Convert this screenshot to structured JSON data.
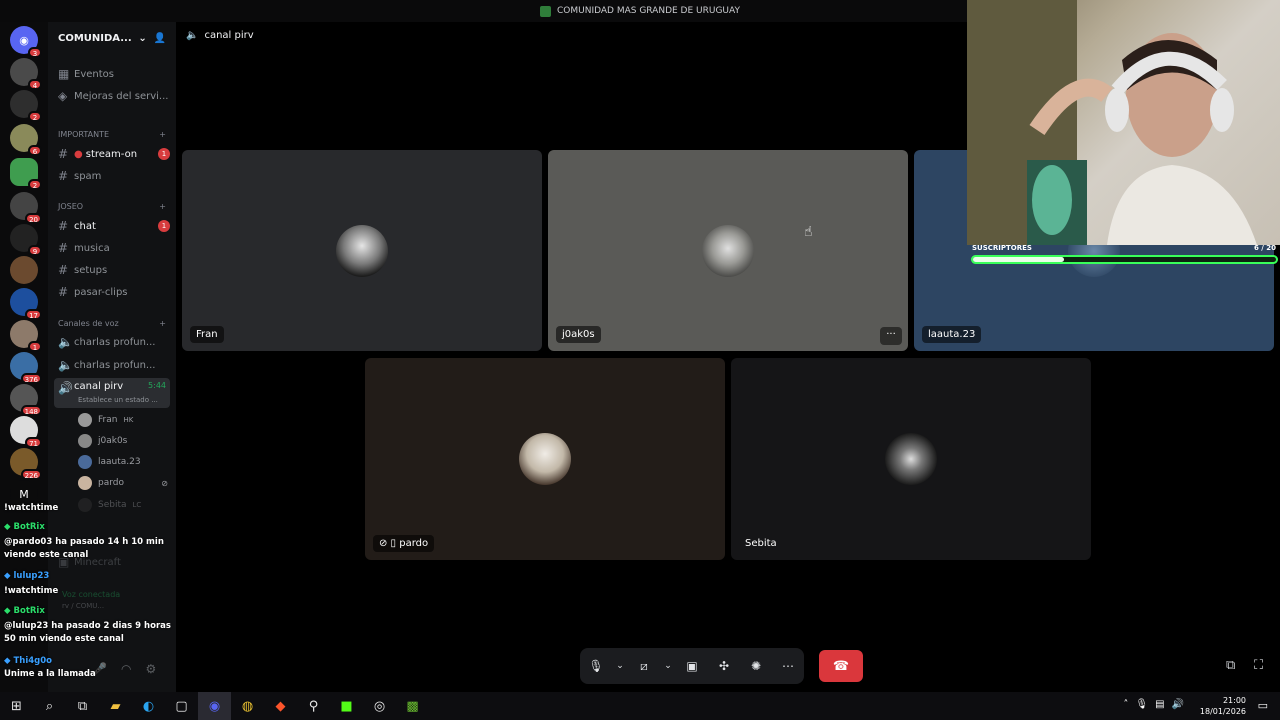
{
  "window_title": "COMUNIDAD MAS GRANDE DE URUGUAY",
  "server": {
    "name": "COMUNIDA...",
    "dropdown_icon": "chevron-down-icon",
    "invite_icon": "add-member-icon"
  },
  "guild_badges": [
    "3",
    "4",
    "2",
    "6",
    "2",
    "20",
    "9",
    "17",
    "1",
    "376",
    "148",
    "71",
    "226"
  ],
  "guild_letter": "M",
  "channels": {
    "events": "Eventos",
    "boosts": "Mejoras del servi...",
    "cat_importante": "IMPORTANTE",
    "stream_on": "stream-on",
    "stream_on_badge": "1",
    "spam": "spam",
    "cat_joseo": "JOSEO",
    "chat": "chat",
    "chat_badge": "1",
    "musica": "musica",
    "setups": "setups",
    "pasar_clips": "pasar-clips",
    "cat_voice": "Canales de voz",
    "voice1": "charlas profun...",
    "voice2": "charlas profun...",
    "canal_pirv": "canal pirv",
    "canal_pirv_time": "5:44",
    "canal_pirv_status": "Establece un estado ...",
    "minecraft": "Minecraft"
  },
  "voice_users": [
    {
      "name": "Fran",
      "tag": "HK"
    },
    {
      "name": "j0ak0s",
      "tag": ""
    },
    {
      "name": "laauta.23",
      "tag": ""
    },
    {
      "name": "pardo",
      "tag": ""
    },
    {
      "name": "Sebita",
      "tag": "LC"
    }
  ],
  "voice_connected": "Voz conectada",
  "voice_connected_sub": "rv / COMU...",
  "chat_overlay": [
    {
      "user": "",
      "text": "!watchtime",
      "type": "msg"
    },
    {
      "user": "BotRix",
      "text": "",
      "type": "bot"
    },
    {
      "user": "",
      "text": "@pardo03 ha pasado 14 h 10 min viendo este canal",
      "type": "msg"
    },
    {
      "user": "lulup23",
      "text": "",
      "type": "usr"
    },
    {
      "user": "",
      "text": "!watchtime",
      "type": "msg"
    },
    {
      "user": "BotRix",
      "text": "",
      "type": "bot"
    },
    {
      "user": "",
      "text": "@lulup23 ha pasado 2 dias 9 horas 50 min viendo este canal",
      "type": "msg"
    },
    {
      "user": "Thi4g0o",
      "text": "",
      "type": "usr"
    },
    {
      "user": "",
      "text": "Unime a la llamada",
      "type": "msg"
    }
  ],
  "stage": {
    "channel_name": "canal pirv",
    "tiles": [
      {
        "name": "Fran"
      },
      {
        "name": "j0ak0s"
      },
      {
        "name": "laauta.23"
      },
      {
        "name": "pardo"
      },
      {
        "name": "Sebita"
      }
    ],
    "more_label": "···"
  },
  "subs": {
    "label": "SUSCRIPTORES",
    "count": "6 / 20",
    "progress": 0.3
  },
  "controls": {
    "mic": "mic-icon",
    "camera": "camera-off-icon",
    "share": "screen-share-icon",
    "activities": "activities-icon",
    "soundboard": "soundboard-icon",
    "more": "more-icon",
    "hangup": "hangup-icon"
  },
  "clock": {
    "time": "21:00",
    "date": "18/01/2026"
  },
  "colors": {
    "accent_red": "#da373c",
    "subs_green": "#39ff5a",
    "badge_red": "#d83c3e"
  }
}
